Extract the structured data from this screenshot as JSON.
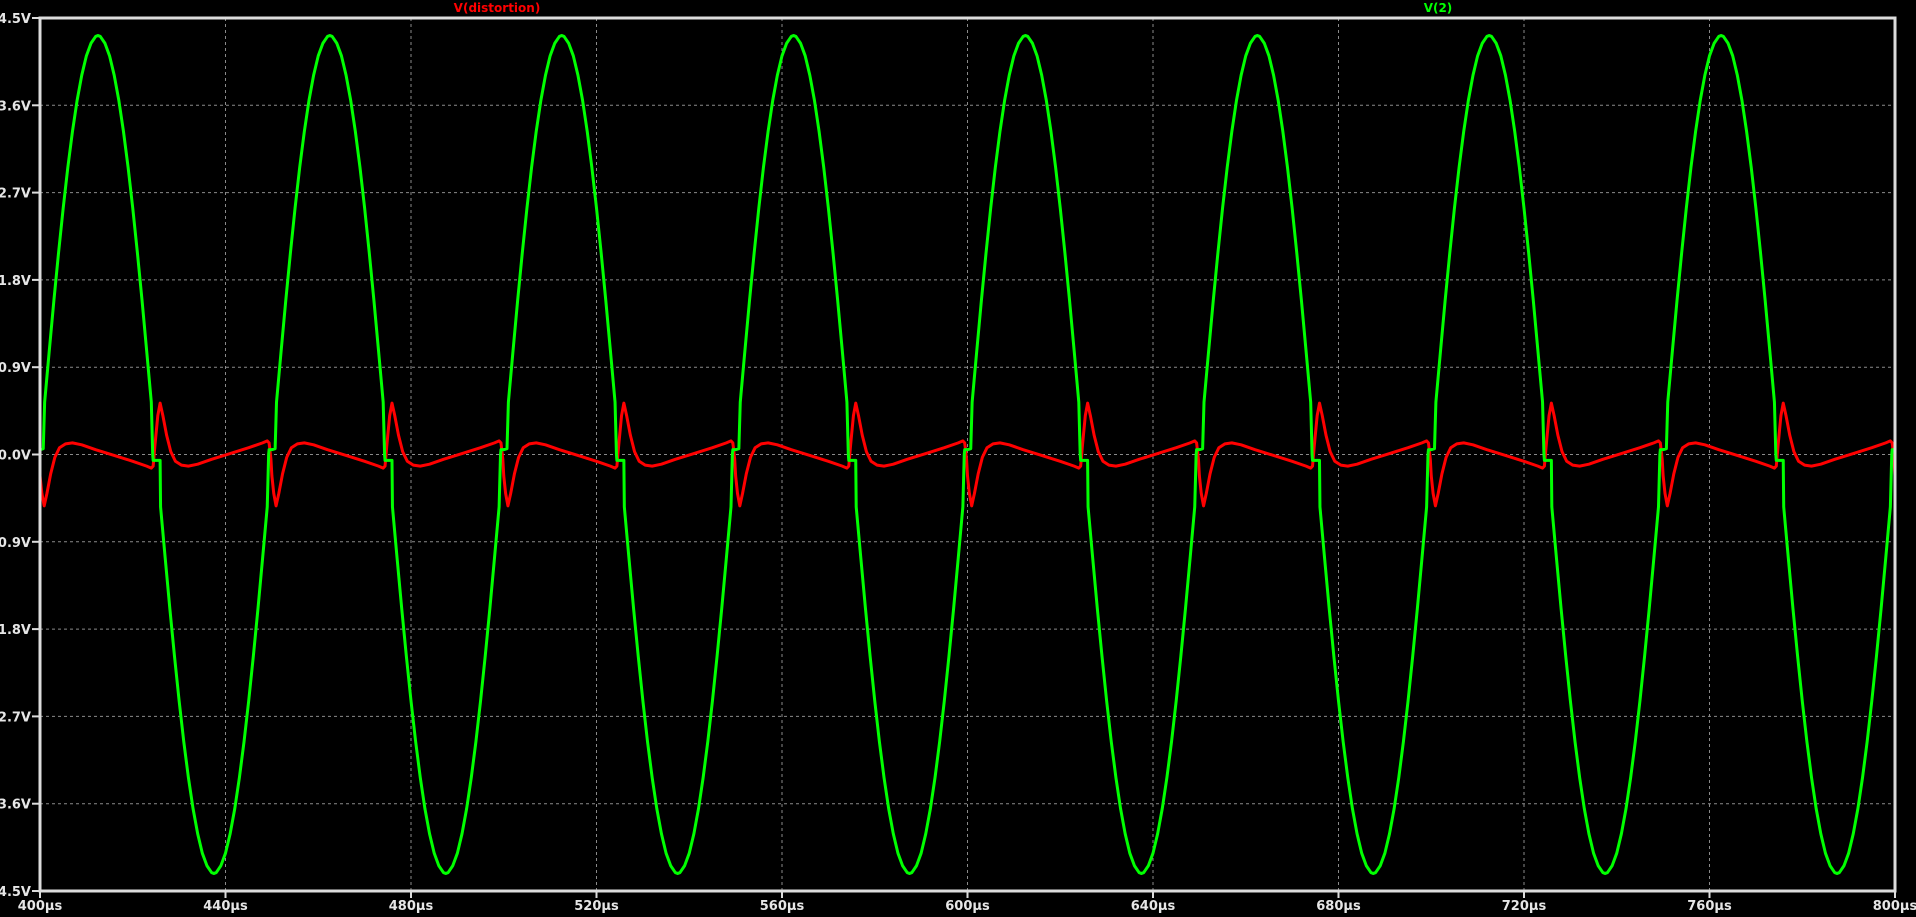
{
  "chart_data": {
    "type": "line",
    "title": "",
    "xlabel": "",
    "ylabel": "",
    "xlim": [
      400,
      800
    ],
    "ylim": [
      -4.5,
      4.5
    ],
    "x_unit": "µs",
    "y_unit": "V",
    "grid": true,
    "background": "#000000",
    "x_ticks": [
      "400µs",
      "440µs",
      "480µs",
      "520µs",
      "560µs",
      "600µs",
      "640µs",
      "680µs",
      "720µs",
      "760µs",
      "800µs"
    ],
    "x_tick_values": [
      400,
      440,
      480,
      520,
      560,
      600,
      640,
      680,
      720,
      760,
      800
    ],
    "y_ticks": [
      "4.5V",
      "3.6V",
      "2.7V",
      "1.8V",
      "0.9V",
      "0.0V",
      "-0.9V",
      "-1.8V",
      "-2.7V",
      "-3.6V",
      "-4.5V"
    ],
    "y_tick_values": [
      4.5,
      3.6,
      2.7,
      1.8,
      0.9,
      0.0,
      -0.9,
      -1.8,
      -2.7,
      -3.6,
      -4.5
    ],
    "series": [
      {
        "name": "V(distortion)",
        "color": "#ff0000",
        "period": 50,
        "x": [
          400,
          400.4,
          400.9,
          401.5,
          402.3,
          403.2,
          404.2,
          405.5,
          407,
          409,
          412,
          416,
          420,
          423,
          424,
          424.4,
          424.8,
          425.4,
          425.9,
          426.5,
          427.3,
          428.2,
          429.2,
          430.5,
          432,
          434,
          437,
          441,
          445,
          448,
          449,
          449.4,
          449.8
        ],
        "y": [
          -0.22,
          -0.4,
          -0.53,
          -0.4,
          -0.2,
          -0.03,
          0.07,
          0.11,
          0.12,
          0.1,
          0.05,
          -0.01,
          -0.07,
          -0.12,
          -0.14,
          -0.12,
          0.1,
          0.4,
          0.53,
          0.4,
          0.2,
          0.03,
          -0.07,
          -0.11,
          -0.12,
          -0.1,
          -0.05,
          0.01,
          0.07,
          0.12,
          0.14,
          0.12,
          -0.05
        ]
      },
      {
        "name": "V(2)",
        "color": "#00ff00",
        "period": 50,
        "x": [
          400,
          400.7,
          401,
          402,
          403,
          404,
          405,
          406,
          407,
          408,
          409,
          410,
          411,
          412,
          412.5,
          413,
          414,
          415,
          416,
          417,
          418,
          419,
          420,
          421,
          422,
          423,
          424,
          424.3,
          424.4,
          425.9,
          426,
          427,
          428,
          429,
          430,
          431,
          432,
          433,
          434,
          435,
          436,
          437,
          437.5,
          438,
          439,
          440,
          441,
          442,
          443,
          444,
          445,
          446,
          447,
          448,
          449,
          449.3,
          449.4
        ],
        "y": [
          0.05,
          0.06,
          0.54,
          1.07,
          1.59,
          2.08,
          2.54,
          2.96,
          3.33,
          3.65,
          3.91,
          4.11,
          4.24,
          4.31,
          4.32,
          4.31,
          4.24,
          4.11,
          3.91,
          3.65,
          3.33,
          2.96,
          2.54,
          2.08,
          1.59,
          1.07,
          0.54,
          0.0,
          -0.06,
          -0.06,
          -0.54,
          -1.07,
          -1.59,
          -2.08,
          -2.54,
          -2.96,
          -3.33,
          -3.65,
          -3.91,
          -4.11,
          -4.24,
          -4.31,
          -4.32,
          -4.31,
          -4.24,
          -4.11,
          -3.91,
          -3.65,
          -3.33,
          -2.96,
          -2.54,
          -2.08,
          -1.59,
          -1.07,
          -0.54,
          0.0,
          0.05
        ]
      }
    ]
  }
}
